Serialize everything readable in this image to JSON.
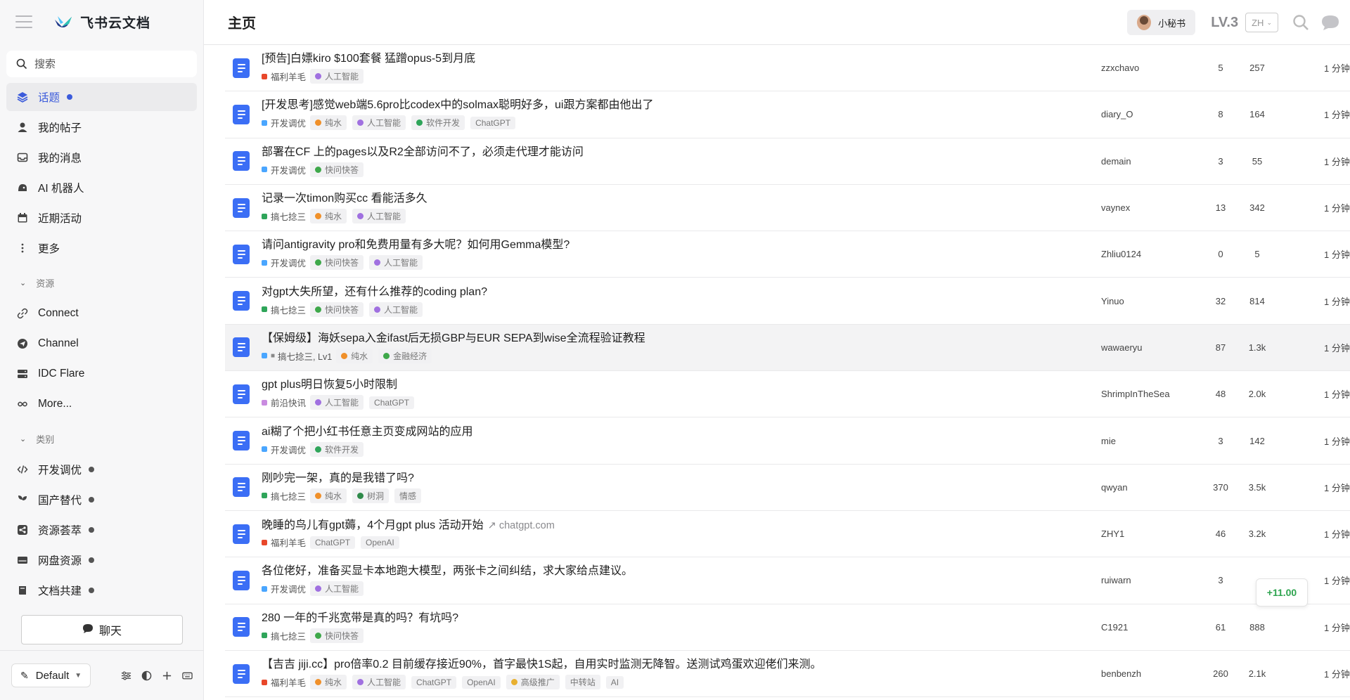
{
  "sidebar": {
    "brand": "飞书云文档",
    "search_placeholder": "搜索",
    "nav": [
      {
        "label": "话题",
        "icon": "layers-icon"
      },
      {
        "label": "我的帖子",
        "icon": "user-icon"
      },
      {
        "label": "我的消息",
        "icon": "inbox-icon"
      },
      {
        "label": "AI 机器人",
        "icon": "robot-icon"
      },
      {
        "label": "近期活动",
        "icon": "calendar-icon"
      },
      {
        "label": "更多",
        "icon": "more-vertical-icon"
      }
    ],
    "resources_title": "资源",
    "resources": [
      {
        "label": "Connect",
        "icon": "link-icon"
      },
      {
        "label": "Channel",
        "icon": "send-icon"
      },
      {
        "label": "IDC Flare",
        "icon": "server-icon"
      },
      {
        "label": "More...",
        "icon": "infinity-icon"
      }
    ],
    "categories_title": "类别",
    "categories": [
      {
        "label": "开发调优",
        "icon": "code-icon"
      },
      {
        "label": "国产替代",
        "icon": "sprout-icon"
      },
      {
        "label": "资源荟萃",
        "icon": "share-icon"
      },
      {
        "label": "网盘资源",
        "icon": "drive-icon"
      },
      {
        "label": "文档共建",
        "icon": "book-icon"
      }
    ],
    "chat_button": "聊天",
    "theme": "Default"
  },
  "header": {
    "title": "主页",
    "secretary": "小秘书",
    "level": "LV.3",
    "language": "ZH"
  },
  "toast": "+11.00",
  "topics": [
    {
      "title": "[预告]白嫖kiro $100套餐 猛蹭opus-5到月底",
      "link": "",
      "category": "福利羊毛",
      "cat_color": "#e8472a",
      "tags": [
        {
          "t": "人工智能",
          "c": "#a070e0"
        }
      ],
      "author": "zzxchavo",
      "replies": "5",
      "views": "257",
      "time": "1 分钟"
    },
    {
      "title": "[开发思考]感觉web端5.6pro比codex中的solmax聪明好多，ui跟方案都由他出了",
      "link": "",
      "category": "开发调优",
      "cat_color": "#4aa6ff",
      "tags": [
        {
          "t": "纯水",
          "c": "#f0902a"
        },
        {
          "t": "人工智能",
          "c": "#a070e0"
        },
        {
          "t": "软件开发",
          "c": "#2fa55a"
        },
        {
          "t": "ChatGPT",
          "c": ""
        }
      ],
      "author": "diary_O",
      "replies": "8",
      "views": "164",
      "time": "1 分钟"
    },
    {
      "title": "部署在CF 上的pages以及R2全部访问不了，必须走代理才能访问",
      "link": "",
      "category": "开发调优",
      "cat_color": "#4aa6ff",
      "tags": [
        {
          "t": "快问快答",
          "c": "#3ea84a"
        }
      ],
      "author": "demain",
      "replies": "3",
      "views": "55",
      "time": "1 分钟"
    },
    {
      "title": "记录一次timon购买cc 看能活多久",
      "link": "",
      "category": "搞七捻三",
      "cat_color": "#2fa55a",
      "tags": [
        {
          "t": "纯水",
          "c": "#f0902a"
        },
        {
          "t": "人工智能",
          "c": "#a070e0"
        }
      ],
      "author": "vaynex",
      "replies": "13",
      "views": "342",
      "time": "1 分钟"
    },
    {
      "title": "请问antigravity pro和免费用量有多大呢？如何用Gemma模型?",
      "link": "",
      "category": "开发调优",
      "cat_color": "#4aa6ff",
      "tags": [
        {
          "t": "快问快答",
          "c": "#3ea84a"
        },
        {
          "t": "人工智能",
          "c": "#a070e0"
        }
      ],
      "author": "Zhliu0124",
      "replies": "0",
      "views": "5",
      "time": "1 分钟"
    },
    {
      "title": "对gpt大失所望，还有什么推荐的coding plan?",
      "link": "",
      "category": "搞七捻三",
      "cat_color": "#2fa55a",
      "tags": [
        {
          "t": "快问快答",
          "c": "#3ea84a"
        },
        {
          "t": "人工智能",
          "c": "#a070e0"
        }
      ],
      "author": "Yinuo",
      "replies": "32",
      "views": "814",
      "time": "1 分钟"
    },
    {
      "title": "【保姆级】海妖sepa入金ifast后无损GBP与EUR SEPA到wise全流程验证教程",
      "link": "",
      "category": "搞七捻三, Lv1",
      "cat_color": "#4aa6ff",
      "tags": [
        {
          "t": "纯水",
          "c": "#f0902a"
        },
        {
          "t": "金融经济",
          "c": "#3ea84a"
        }
      ],
      "author": "wawaeryu",
      "replies": "87",
      "views": "1.3k",
      "time": "1 分钟"
    },
    {
      "title": "gpt plus明日恢复5小时限制",
      "link": "",
      "category": "前沿快讯",
      "cat_color": "#c98be0",
      "tags": [
        {
          "t": "人工智能",
          "c": "#a070e0"
        },
        {
          "t": "ChatGPT",
          "c": ""
        }
      ],
      "author": "ShrimpInTheSea",
      "replies": "48",
      "views": "2.0k",
      "time": "1 分钟"
    },
    {
      "title": "ai糊了个把小红书任意主页变成网站的应用",
      "link": "",
      "category": "开发调优",
      "cat_color": "#4aa6ff",
      "tags": [
        {
          "t": "软件开发",
          "c": "#2fa55a"
        }
      ],
      "author": "mie",
      "replies": "3",
      "views": "142",
      "time": "1 分钟"
    },
    {
      "title": "刚吵完一架，真的是我错了吗?",
      "link": "",
      "category": "搞七捻三",
      "cat_color": "#2fa55a",
      "tags": [
        {
          "t": "纯水",
          "c": "#f0902a"
        },
        {
          "t": "树洞",
          "c": "#2f8a4a"
        },
        {
          "t": "情感",
          "c": ""
        }
      ],
      "author": "qwyan",
      "replies": "370",
      "views": "3.5k",
      "time": "1 分钟"
    },
    {
      "title": "晚睡的鸟儿有gpt薅，4个月gpt plus 活动开始",
      "link": "chatgpt.com",
      "category": "福利羊毛",
      "cat_color": "#e8472a",
      "tags": [
        {
          "t": "ChatGPT",
          "c": ""
        },
        {
          "t": "OpenAI",
          "c": ""
        }
      ],
      "author": "ZHY1",
      "replies": "46",
      "views": "3.2k",
      "time": "1 分钟"
    },
    {
      "title": "各位佬好，准备买显卡本地跑大模型，两张卡之间纠结，求大家给点建议。",
      "link": "",
      "category": "开发调优",
      "cat_color": "#4aa6ff",
      "tags": [
        {
          "t": "人工智能",
          "c": "#a070e0"
        }
      ],
      "author": "ruiwarn",
      "replies": "3",
      "views": "",
      "time": "1 分钟"
    },
    {
      "title": "280 一年的千兆宽带是真的吗？有坑吗?",
      "link": "",
      "category": "搞七捻三",
      "cat_color": "#2fa55a",
      "tags": [
        {
          "t": "快问快答",
          "c": "#3ea84a"
        }
      ],
      "author": "C1921",
      "replies": "61",
      "views": "888",
      "time": "1 分钟"
    },
    {
      "title": "【吉吉 jiji.cc】pro倍率0.2 目前缓存接近90%，首字最快1S起，自用实时监测无降智。送测试鸡蛋欢迎佬们来测。",
      "link": "",
      "category": "福利羊毛",
      "cat_color": "#e8472a",
      "tags": [
        {
          "t": "纯水",
          "c": "#f0902a"
        },
        {
          "t": "人工智能",
          "c": "#a070e0"
        },
        {
          "t": "ChatGPT",
          "c": ""
        },
        {
          "t": "OpenAI",
          "c": ""
        },
        {
          "t": "高级推广",
          "c": "#e8b030"
        },
        {
          "t": "中转站",
          "c": ""
        },
        {
          "t": "AI",
          "c": ""
        }
      ],
      "author": "benbenzh",
      "replies": "260",
      "views": "2.1k",
      "time": "1 分钟"
    }
  ]
}
